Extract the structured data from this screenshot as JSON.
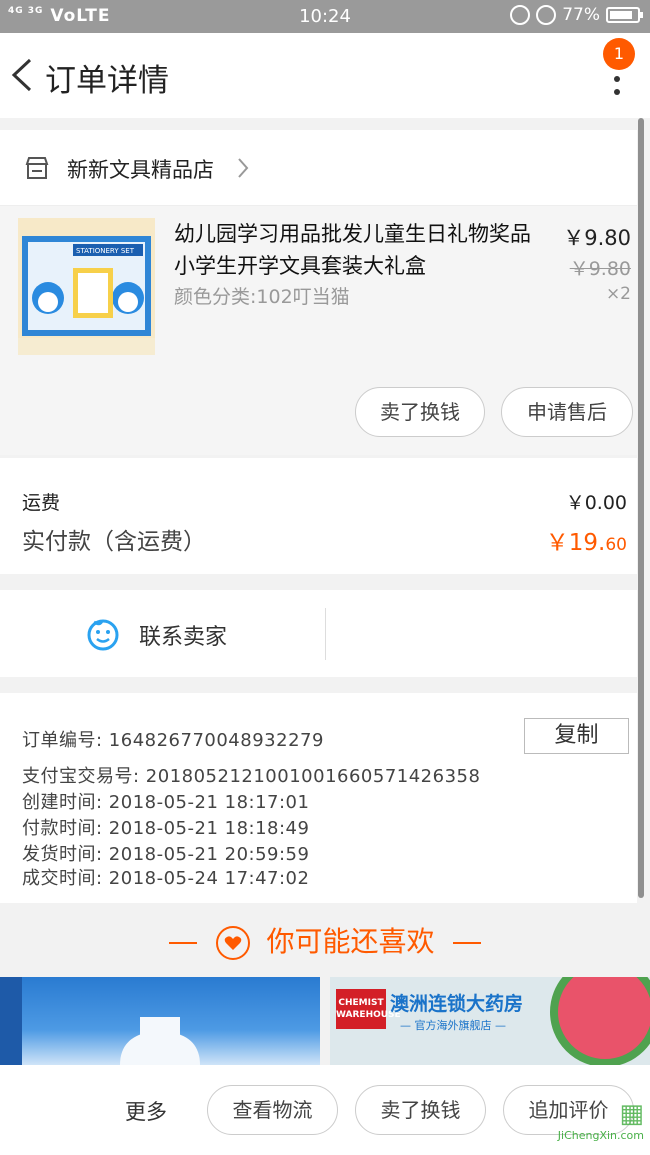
{
  "status_bar": {
    "signal": "VoLTE",
    "signal_small": "4G 3G",
    "time": "10:24",
    "battery": "77%"
  },
  "header": {
    "title": "订单详情",
    "badge_count": "1"
  },
  "shop": {
    "name": "新新文具精品店"
  },
  "product": {
    "name": "幼儿园学习用品批发儿童生日礼物奖品小学生开学文具套装大礼盒",
    "sku": "颜色分类:102叮当猫",
    "price": "￥9.80",
    "original_price": "￥9.80",
    "quantity": "×2",
    "image_label": "STATIONERY SET",
    "buttons": {
      "sell": "卖了换钱",
      "after_sale": "申请售后"
    }
  },
  "fees": {
    "shipping_label": "运费",
    "shipping_value": "￥0.00",
    "paid_label": "实付款（含运费）",
    "paid_int": "￥19.",
    "paid_dec": "60"
  },
  "contact": {
    "label": "联系卖家"
  },
  "order_info": {
    "order_no": "订单编号:   164826770048932279",
    "copy": "复制",
    "alipay_no": "支付宝交易号:   2018052121001001660571426358",
    "created": "创建时间:   2018-05-21  18:17:01",
    "paid": "付款时间:   2018-05-21  18:18:49",
    "shipped": "发货时间:   2018-05-21  20:59:59",
    "completed": "成交时间:   2018-05-24  17:47:02"
  },
  "recommend": {
    "title": "你可能还喜欢",
    "store_logo": "CHEMIST WAREHOUSE",
    "store_name": "澳洲连锁大药房",
    "store_sub": "— 官方海外旗舰店 —"
  },
  "bottom_bar": {
    "more": "更多",
    "logistics": "查看物流",
    "sell": "卖了换钱",
    "review": "追加评价"
  },
  "watermark": {
    "text": "JiChengXin.com"
  },
  "colors": {
    "accent": "#ff5a00",
    "contact_icon": "#2aa2f0"
  }
}
